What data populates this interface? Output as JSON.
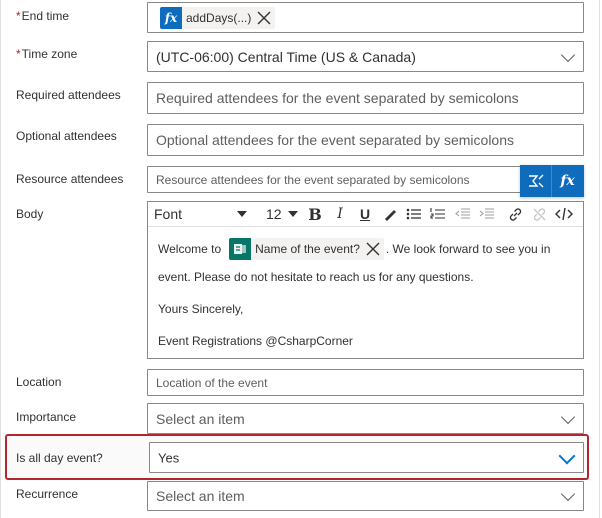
{
  "fields": {
    "end_time": {
      "label": "End time",
      "required": true,
      "token_text": "addDays(...)",
      "token_icon": "fx-icon"
    },
    "time_zone": {
      "label": "Time zone",
      "required": true,
      "value": "(UTC-06:00) Central Time (US & Canada)"
    },
    "required_attendees": {
      "label": "Required attendees",
      "placeholder": "Required attendees for the event separated by semicolons"
    },
    "optional_attendees": {
      "label": "Optional attendees",
      "placeholder": "Optional attendees for the event separated by semicolons"
    },
    "resource_attendees": {
      "label": "Resource attendees",
      "placeholder": "Resource attendees for the event separated by semicolons"
    },
    "body": {
      "label": "Body",
      "toolbar": {
        "font": "Font",
        "size": "12",
        "bold": "B",
        "italic": "I",
        "underline": "U"
      },
      "greeting": "Welcome to",
      "token_text": "Name of the event?",
      "after_token": ". We look forward to see you in",
      "line2": "event. Please do not hesitate to reach us for any questions.",
      "line3": "Yours Sincerely,",
      "line4": "Event Registrations @CsharpCorner"
    },
    "location": {
      "label": "Location",
      "placeholder": "Location of the event"
    },
    "importance": {
      "label": "Importance",
      "placeholder": "Select an item"
    },
    "all_day": {
      "label": "Is all day event?",
      "value": "Yes"
    },
    "recurrence": {
      "label": "Recurrence",
      "placeholder": "Select an item"
    }
  },
  "fxbar": {
    "fx_label": "fx"
  },
  "colors": {
    "accent": "#0f6cbd",
    "highlight": "#b3262d",
    "forms": "#077568"
  }
}
